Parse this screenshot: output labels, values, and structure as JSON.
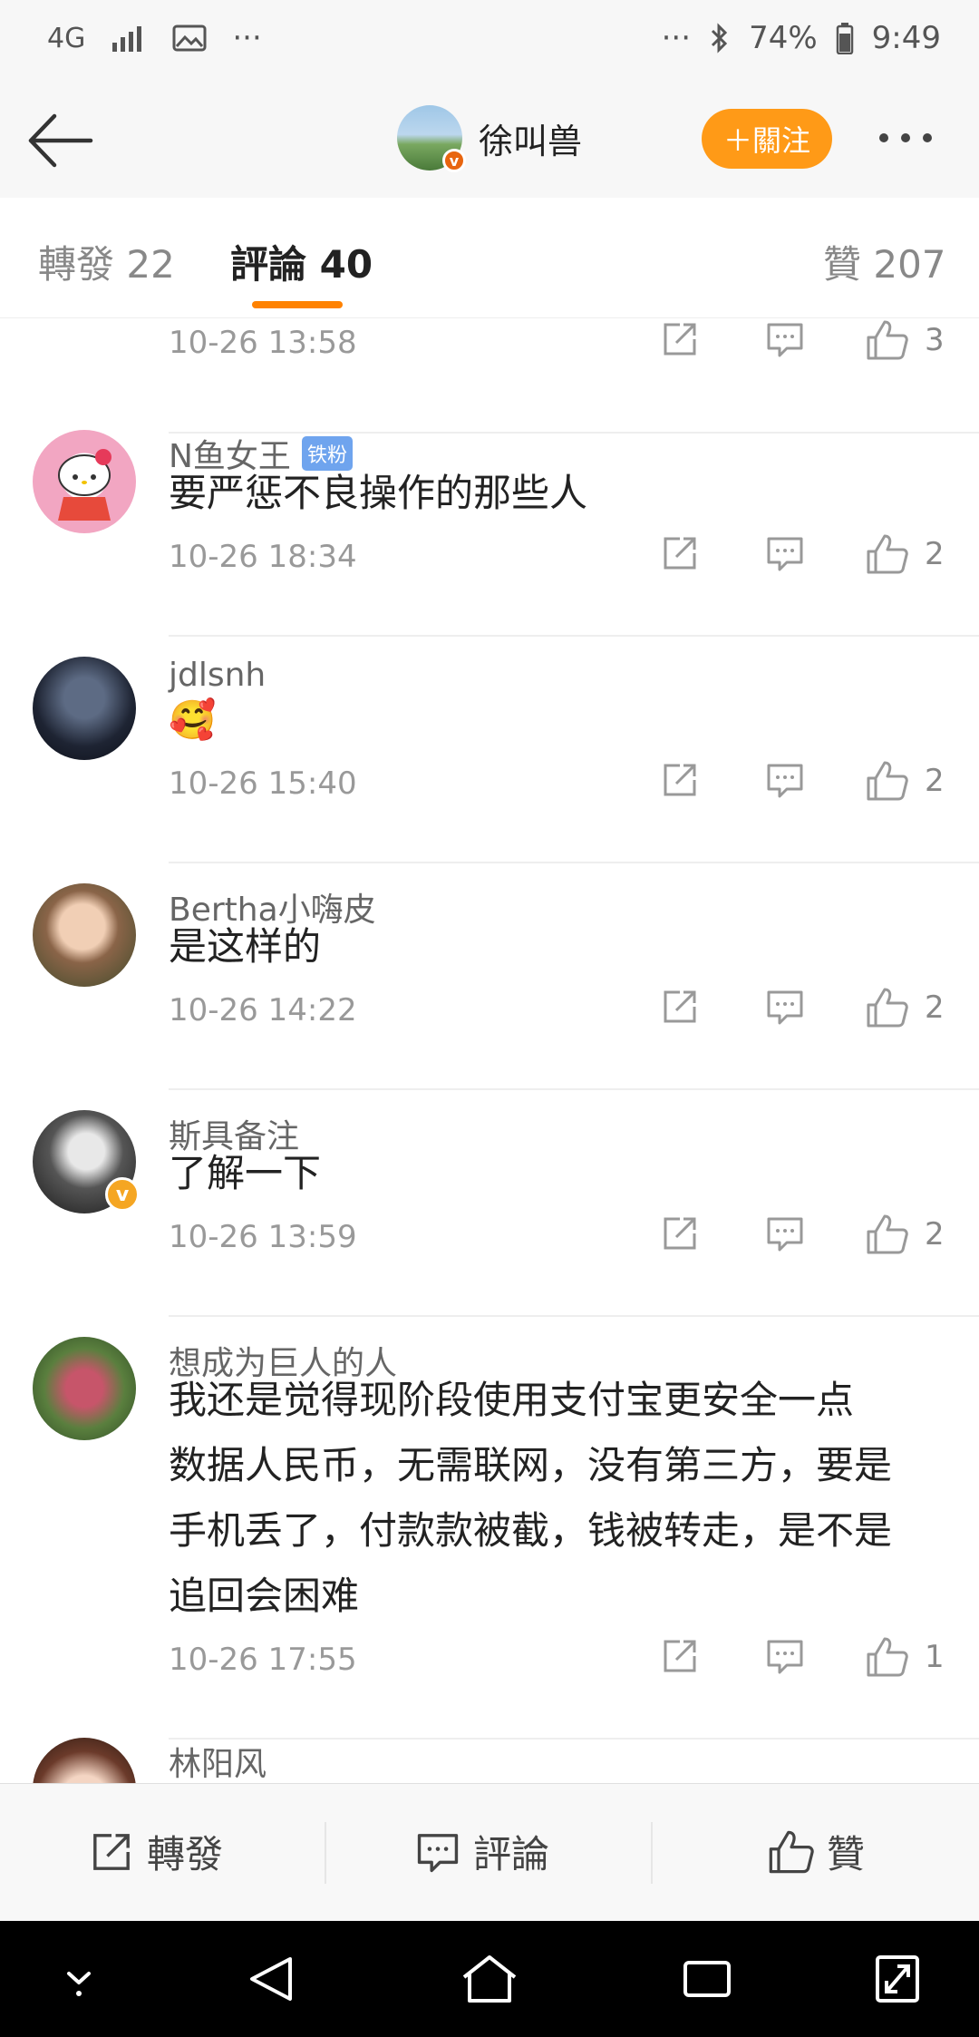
{
  "status": {
    "network": "4G",
    "battery": "74%",
    "time": "9:49",
    "overflow": "···"
  },
  "header": {
    "username": "徐叫兽",
    "verified_mark": "v",
    "follow_label": "＋關注"
  },
  "tabs": [
    {
      "label": "轉發 22",
      "active": false
    },
    {
      "label": "評論 40",
      "active": true
    },
    {
      "label": "贊 207",
      "active": false
    }
  ],
  "comments": [
    {
      "name": "",
      "text": "",
      "time": "10-26 13:58",
      "likes": "3"
    },
    {
      "name": "N鱼女王",
      "badge": "铁粉",
      "text": "要严惩不良操作的那些人",
      "time": "10-26 18:34",
      "likes": "2"
    },
    {
      "name": "jdlsnh",
      "text": "🥰",
      "time": "10-26 15:40",
      "likes": "2"
    },
    {
      "name": "Bertha小嗨皮",
      "text": "是这样的",
      "time": "10-26 14:22",
      "likes": "2"
    },
    {
      "name": "斯具备注",
      "verified_mark": "v",
      "text": "了解一下",
      "time": "10-26 13:59",
      "likes": "2"
    },
    {
      "name": "想成为巨人的人",
      "text_lines": [
        "我还是觉得现阶段使用支付宝更安全一点",
        "数据人民币，无需联网，没有第三方，要是",
        "手机丢了，付款款被截，钱被转走，是不是",
        "追回会困难"
      ],
      "time": "10-26 17:55",
      "likes": "1"
    },
    {
      "name": "林阳风"
    }
  ],
  "bottom_bar": {
    "repost": "轉發",
    "comment": "評論",
    "like": "贊"
  },
  "colors": {
    "accent": "#ff8200",
    "follow_bg": "#ff9a17",
    "fan_badge": "#6fa4ee"
  }
}
